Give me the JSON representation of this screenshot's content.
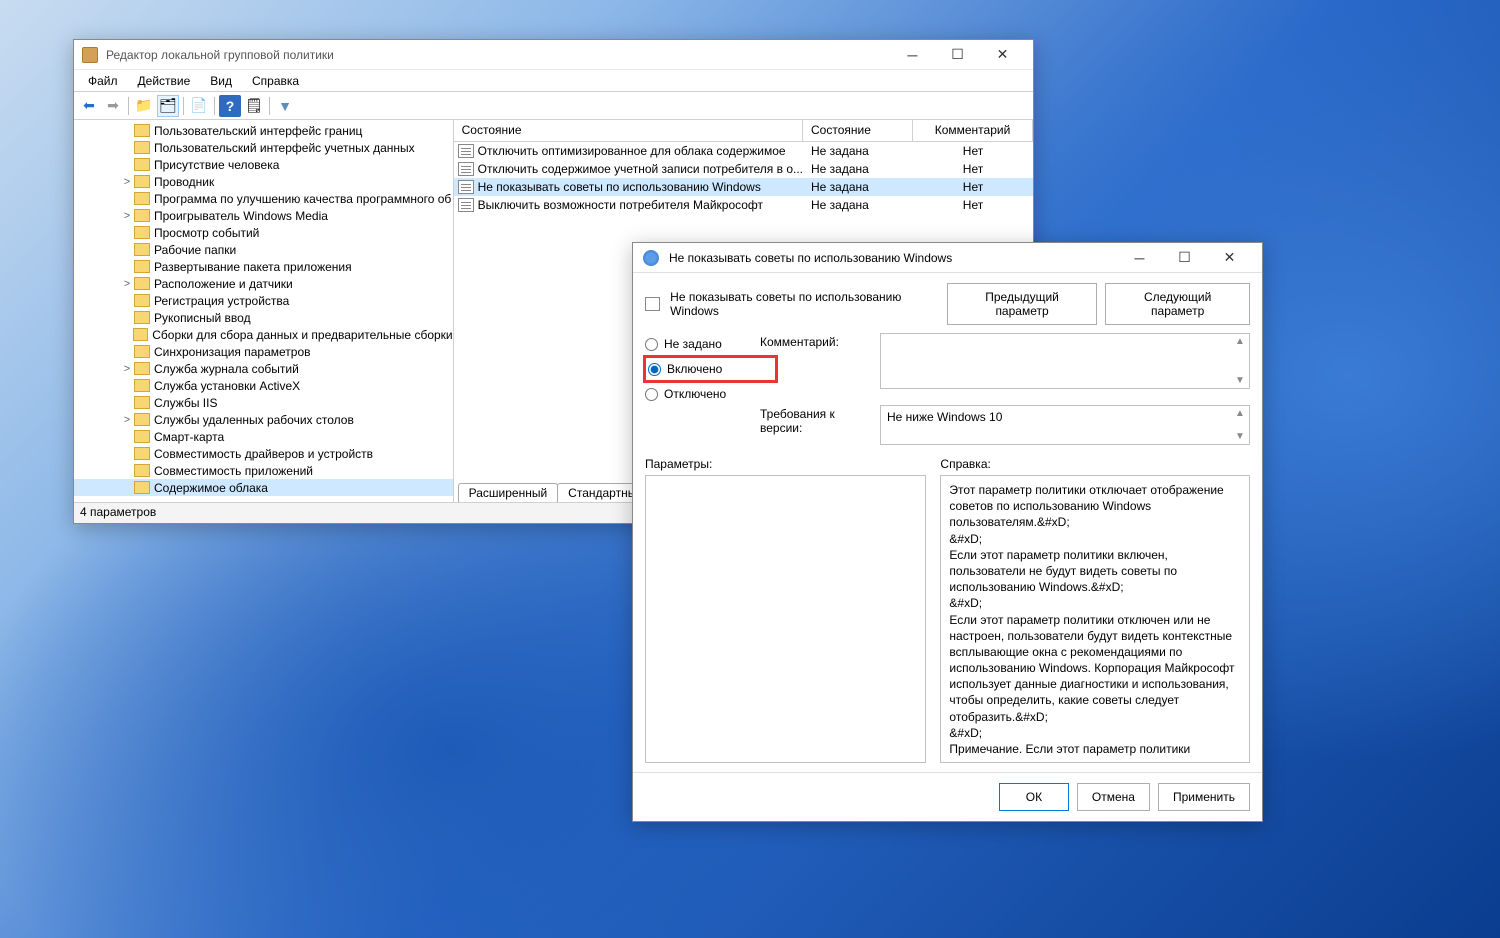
{
  "gpedit": {
    "title": "Редактор локальной групповой политики",
    "menus": [
      "Файл",
      "Действие",
      "Вид",
      "Справка"
    ],
    "tree": [
      {
        "label": "Пользовательский интерфейс границ",
        "indent": 60
      },
      {
        "label": "Пользовательский интерфейс учетных данных",
        "indent": 60
      },
      {
        "label": "Присутствие человека",
        "indent": 60
      },
      {
        "label": "Проводник",
        "indent": 60,
        "expander": ">"
      },
      {
        "label": "Программа по улучшению качества программного об",
        "indent": 60
      },
      {
        "label": "Проигрыватель Windows Media",
        "indent": 60,
        "expander": ">"
      },
      {
        "label": "Просмотр событий",
        "indent": 60
      },
      {
        "label": "Рабочие папки",
        "indent": 60
      },
      {
        "label": "Развертывание пакета приложения",
        "indent": 60
      },
      {
        "label": "Расположение и датчики",
        "indent": 60,
        "expander": ">"
      },
      {
        "label": "Регистрация устройства",
        "indent": 60
      },
      {
        "label": "Рукописный ввод",
        "indent": 60
      },
      {
        "label": "Сборки для сбора данных и предварительные сборки",
        "indent": 60
      },
      {
        "label": "Синхронизация параметров",
        "indent": 60
      },
      {
        "label": "Служба журнала событий",
        "indent": 60,
        "expander": ">"
      },
      {
        "label": "Служба установки ActiveX",
        "indent": 60
      },
      {
        "label": "Службы IIS",
        "indent": 60
      },
      {
        "label": "Службы удаленных рабочих столов",
        "indent": 60,
        "expander": ">"
      },
      {
        "label": "Смарт-карта",
        "indent": 60
      },
      {
        "label": "Совместимость драйверов и устройств",
        "indent": 60
      },
      {
        "label": "Совместимость приложений",
        "indent": 60
      },
      {
        "label": "Содержимое облака",
        "indent": 60,
        "selected": true
      }
    ],
    "list_headers": {
      "c1": "Состояние",
      "c2": "Состояние",
      "c3": "Комментарий"
    },
    "list": [
      {
        "c1": "Отключить оптимизированное для облака содержимое",
        "c2": "Не задана",
        "c3": "Нет"
      },
      {
        "c1": "Отключить содержимое учетной записи потребителя в о...",
        "c2": "Не задана",
        "c3": "Нет"
      },
      {
        "c1": "Не показывать советы по использованию Windows",
        "c2": "Не задана",
        "c3": "Нет",
        "selected": true
      },
      {
        "c1": "Выключить возможности потребителя Майкрософт",
        "c2": "Не задана",
        "c3": "Нет"
      }
    ],
    "view_tabs": [
      "Расширенный",
      "Стандартный"
    ],
    "status": "4 параметров"
  },
  "dialog": {
    "title": "Не показывать советы по использованию Windows",
    "setting_name": "Не показывать советы по использованию Windows",
    "prev_btn": "Предыдущий параметр",
    "next_btn": "Следующий параметр",
    "radio_not_configured": "Не задано",
    "radio_enabled": "Включено",
    "radio_disabled": "Отключено",
    "comment_label": "Комментарий:",
    "requirements_label": "Требования к версии:",
    "requirements_value": "Не ниже Windows 10",
    "params_label": "Параметры:",
    "help_label": "Справка:",
    "help_text": "Этот параметр политики отключает отображение советов по использованию Windows пользователям.&#xD;\n&#xD;\nЕсли этот параметр политики включен, пользователи не будут видеть советы по использованию Windows.&#xD;\n&#xD;\nЕсли этот параметр политики отключен или не настроен, пользователи будут видеть контекстные всплывающие окна с рекомендациями по использованию Windows. Корпорация Майкрософт использует данные диагностики и использования, чтобы определить, какие советы следует отобразить.&#xD;\n&#xD;\nПримечание. Если этот параметр политики отключен или не настроен, но включен параметр политики \"Конфигурация компьютера\\Административные шаблоны\\Компоненты Windows\\Сборки для сбора данных и предварительные сборки\\Разрешить телеметрию\" с уровнем \"Базовый\" или ниже, пользователи могут видеть ограниченный набор советов.&#xD;\nТакже этот параметр применяется только к SKU",
    "ok": "ОК",
    "cancel": "Отмена",
    "apply": "Применить"
  }
}
